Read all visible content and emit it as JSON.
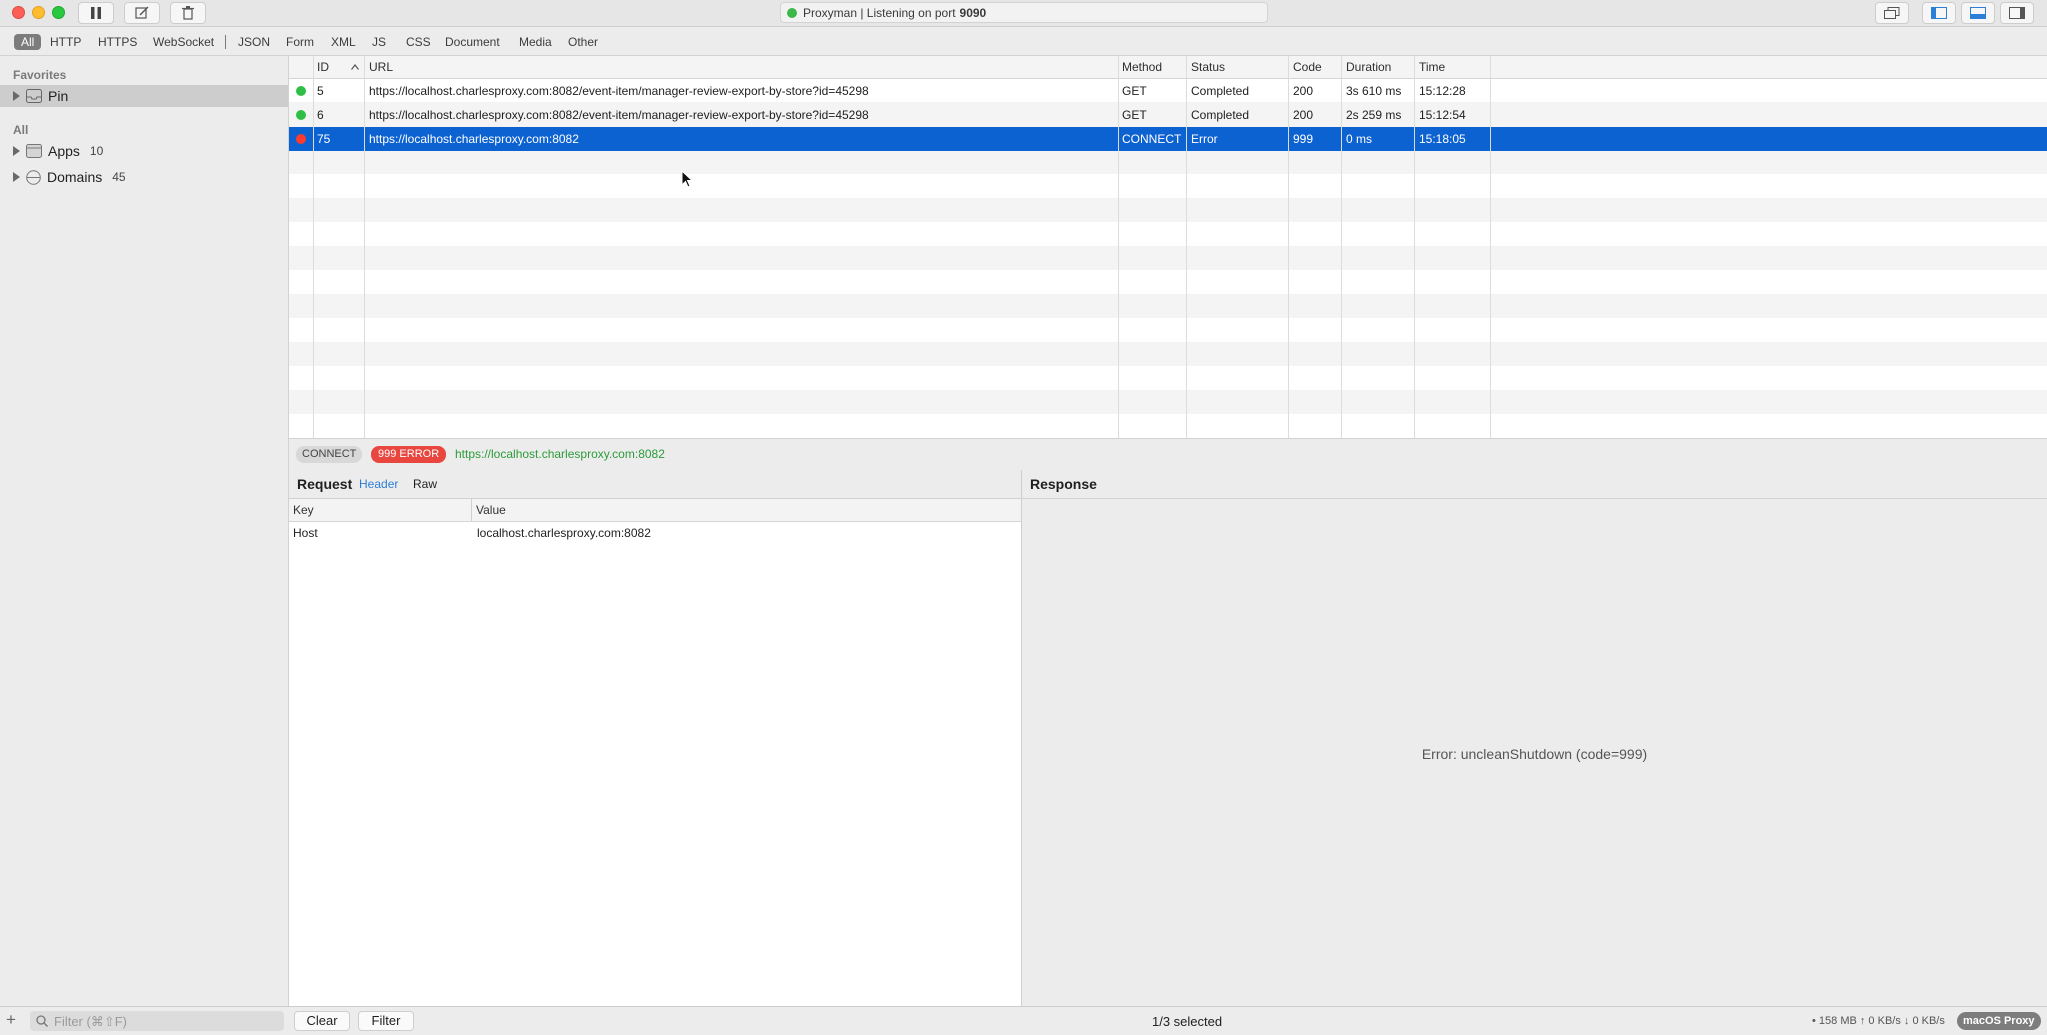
{
  "window": {
    "title_text": "Proxyman | Listening on port",
    "title_port": "9090"
  },
  "filter_tabs": [
    "All",
    "HTTP",
    "HTTPS",
    "WebSocket",
    "JSON",
    "Form",
    "XML",
    "JS",
    "CSS",
    "Document",
    "Media",
    "Other"
  ],
  "sidebar": {
    "favorites_header": "Favorites",
    "pin_label": "Pin",
    "all_header": "All",
    "apps_label": "Apps",
    "apps_count": "10",
    "domains_label": "Domains",
    "domains_count": "45"
  },
  "table": {
    "headers": {
      "id": "ID",
      "url": "URL",
      "method": "Method",
      "status": "Status",
      "code": "Code",
      "duration": "Duration",
      "time": "Time"
    },
    "rows": [
      {
        "id": "5",
        "url": "https://localhost.charlesproxy.com:8082/event-item/manager-review-export-by-store?id=45298",
        "method": "GET",
        "status": "Completed",
        "code": "200",
        "duration": "3s 610 ms",
        "time": "15:12:28"
      },
      {
        "id": "6",
        "url": "https://localhost.charlesproxy.com:8082/event-item/manager-review-export-by-store?id=45298",
        "method": "GET",
        "status": "Completed",
        "code": "200",
        "duration": "2s 259 ms",
        "time": "15:12:54"
      },
      {
        "id": "75",
        "url": "https://localhost.charlesproxy.com:8082",
        "method": "CONNECT",
        "status": "Error",
        "code": "999",
        "duration": "0 ms",
        "time": "15:18:05"
      }
    ]
  },
  "summary": {
    "method": "CONNECT",
    "error_badge": "999 ERROR",
    "url": "https://localhost.charlesproxy.com:8082"
  },
  "request": {
    "title": "Request",
    "tab_header": "Header",
    "tab_raw": "Raw",
    "key_header": "Key",
    "value_header": "Value",
    "row_key": "Host",
    "row_value": "localhost.charlesproxy.com:8082"
  },
  "response": {
    "title": "Response",
    "error_text": "Error: uncleanShutdown (code=999)"
  },
  "bottom": {
    "filter_placeholder": "Filter (⌘⇧F)",
    "clear_label": "Clear",
    "filter_label": "Filter",
    "selection": "1/3 selected",
    "stats": "• 158 MB ↑ 0 KB/s ↓ 0 KB/s",
    "proxy_badge": "macOS Proxy"
  },
  "colors": {
    "selection": "#0d62d1",
    "success_dot": "#2fbf46",
    "error_dot": "#ff3b30",
    "error_badge": "#e8463f",
    "url_green": "#2c9b3a",
    "tab_blue": "#2d7ed6"
  }
}
